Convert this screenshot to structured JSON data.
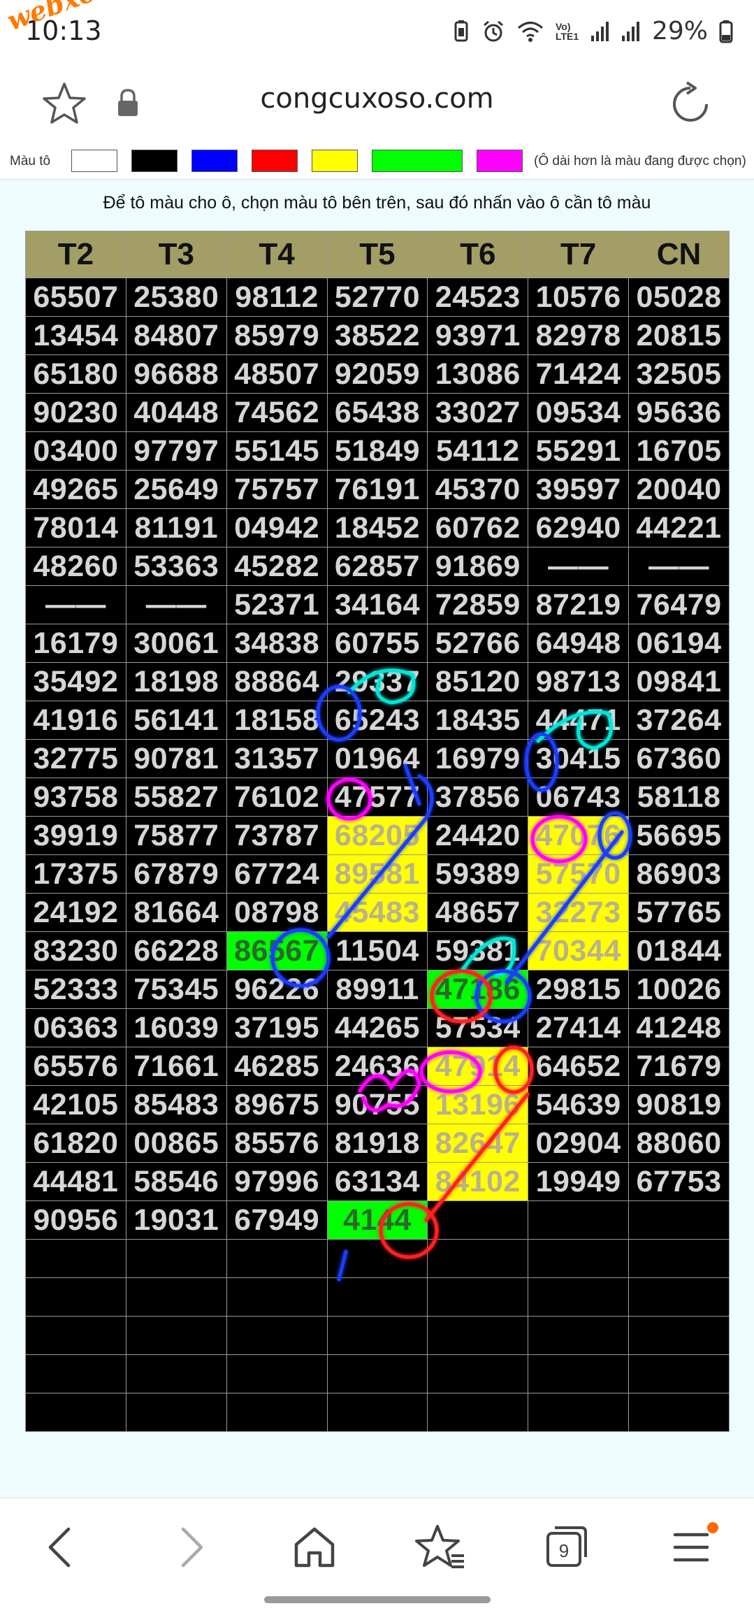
{
  "status": {
    "time": "10:13",
    "watermark": "webxoso.net",
    "network": "Vo) LTE1",
    "battery": "29%"
  },
  "browser": {
    "url": "congcuxoso.com"
  },
  "palette": {
    "label": "Màu tô",
    "hint": "(Ô dài hơn là màu đang được chọn)",
    "swatches": [
      "#ffffff",
      "#000000",
      "#0000ff",
      "#ff0000",
      "#ffff00",
      "#00ff00",
      "#ff00ff"
    ],
    "selected": "#00ff00"
  },
  "instruction": "Để tô màu cho ô, chọn màu tô bên trên, sau đó nhấn vào ô cần tô màu",
  "grid": {
    "headers": [
      "T2",
      "T3",
      "T4",
      "T5",
      "T6",
      "T7",
      "CN"
    ],
    "rows": [
      [
        "65507",
        "25380",
        "98112",
        "52770",
        "24523",
        "10576",
        "05028"
      ],
      [
        "13454",
        "84807",
        "85979",
        "38522",
        "93971",
        "82978",
        "20815"
      ],
      [
        "65180",
        "96688",
        "48507",
        "92059",
        "13086",
        "71424",
        "32505"
      ],
      [
        "90230",
        "40448",
        "74562",
        "65438",
        "33027",
        "09534",
        "95636"
      ],
      [
        "03400",
        "97797",
        "55145",
        "51849",
        "54112",
        "55291",
        "16705"
      ],
      [
        "49265",
        "25649",
        "75757",
        "76191",
        "45370",
        "39597",
        "20040"
      ],
      [
        "78014",
        "81191",
        "04942",
        "18452",
        "60762",
        "62940",
        "44221"
      ],
      [
        "48260",
        "53363",
        "45282",
        "62857",
        "91869",
        "——",
        "——"
      ],
      [
        "——",
        "——",
        "52371",
        "34164",
        "72859",
        "87219",
        "76479"
      ],
      [
        "16179",
        "30061",
        "34838",
        "60755",
        "52766",
        "64948",
        "06194"
      ],
      [
        "35492",
        "18198",
        "88864",
        "29337",
        "85120",
        "98713",
        "09841"
      ],
      [
        "41916",
        "56141",
        "18158",
        "65243",
        "18435",
        "44471",
        "37264"
      ],
      [
        "32775",
        "90781",
        "31357",
        "01964",
        "16979",
        "30415",
        "67360"
      ],
      [
        "93758",
        "55827",
        "76102",
        "47577",
        "37856",
        "06743",
        "58118"
      ],
      [
        "39919",
        "75877",
        "73787",
        "68205",
        "24420",
        "47076",
        "56695"
      ],
      [
        "17375",
        "67879",
        "67724",
        "89581",
        "59389",
        "57570",
        "86903"
      ],
      [
        "24192",
        "81664",
        "08798",
        "45483",
        "48657",
        "32273",
        "57765"
      ],
      [
        "83230",
        "66228",
        "86567",
        "11504",
        "59381",
        "70344",
        "01844"
      ],
      [
        "52333",
        "75345",
        "96226",
        "89911",
        "47186",
        "29815",
        "10026"
      ],
      [
        "06363",
        "16039",
        "37195",
        "44265",
        "57534",
        "27414",
        "41248"
      ],
      [
        "65576",
        "71661",
        "46285",
        "24636",
        "47914",
        "64652",
        "71679"
      ],
      [
        "42105",
        "85483",
        "89675",
        "90755",
        "13196",
        "54639",
        "90819"
      ],
      [
        "61820",
        "00865",
        "85576",
        "81918",
        "82647",
        "02904",
        "88060"
      ],
      [
        "44481",
        "58546",
        "97996",
        "63134",
        "84102",
        "19949",
        "67753"
      ],
      [
        "90956",
        "19031",
        "67949",
        "4144",
        "",
        "",
        ""
      ],
      [
        "",
        "",
        "",
        "",
        "",
        "",
        ""
      ],
      [
        "",
        "",
        "",
        "",
        "",
        "",
        ""
      ],
      [
        "",
        "",
        "",
        "",
        "",
        "",
        ""
      ],
      [
        "",
        "",
        "",
        "",
        "",
        "",
        ""
      ],
      [
        "",
        "",
        "",
        "",
        "",
        "",
        ""
      ]
    ],
    "highlights": [
      {
        "row": 14,
        "col": 3,
        "color": "yellow"
      },
      {
        "row": 15,
        "col": 3,
        "color": "yellow"
      },
      {
        "row": 16,
        "col": 3,
        "color": "yellow"
      },
      {
        "row": 14,
        "col": 5,
        "color": "yellow"
      },
      {
        "row": 15,
        "col": 5,
        "color": "yellow"
      },
      {
        "row": 16,
        "col": 5,
        "color": "yellow"
      },
      {
        "row": 17,
        "col": 5,
        "color": "yellow"
      },
      {
        "row": 17,
        "col": 2,
        "color": "green"
      },
      {
        "row": 18,
        "col": 4,
        "color": "green"
      },
      {
        "row": 24,
        "col": 3,
        "color": "green"
      },
      {
        "row": 20,
        "col": 4,
        "color": "yellow"
      },
      {
        "row": 21,
        "col": 4,
        "color": "yellow"
      },
      {
        "row": 22,
        "col": 4,
        "color": "yellow"
      },
      {
        "row": 23,
        "col": 4,
        "color": "yellow"
      }
    ]
  },
  "nav": {
    "tabs_count": "9"
  },
  "icons": [
    "star-icon",
    "lock-icon",
    "reload-icon",
    "back-icon",
    "forward-icon",
    "home-icon",
    "bookmarks-icon",
    "tabs-icon",
    "menu-icon"
  ]
}
